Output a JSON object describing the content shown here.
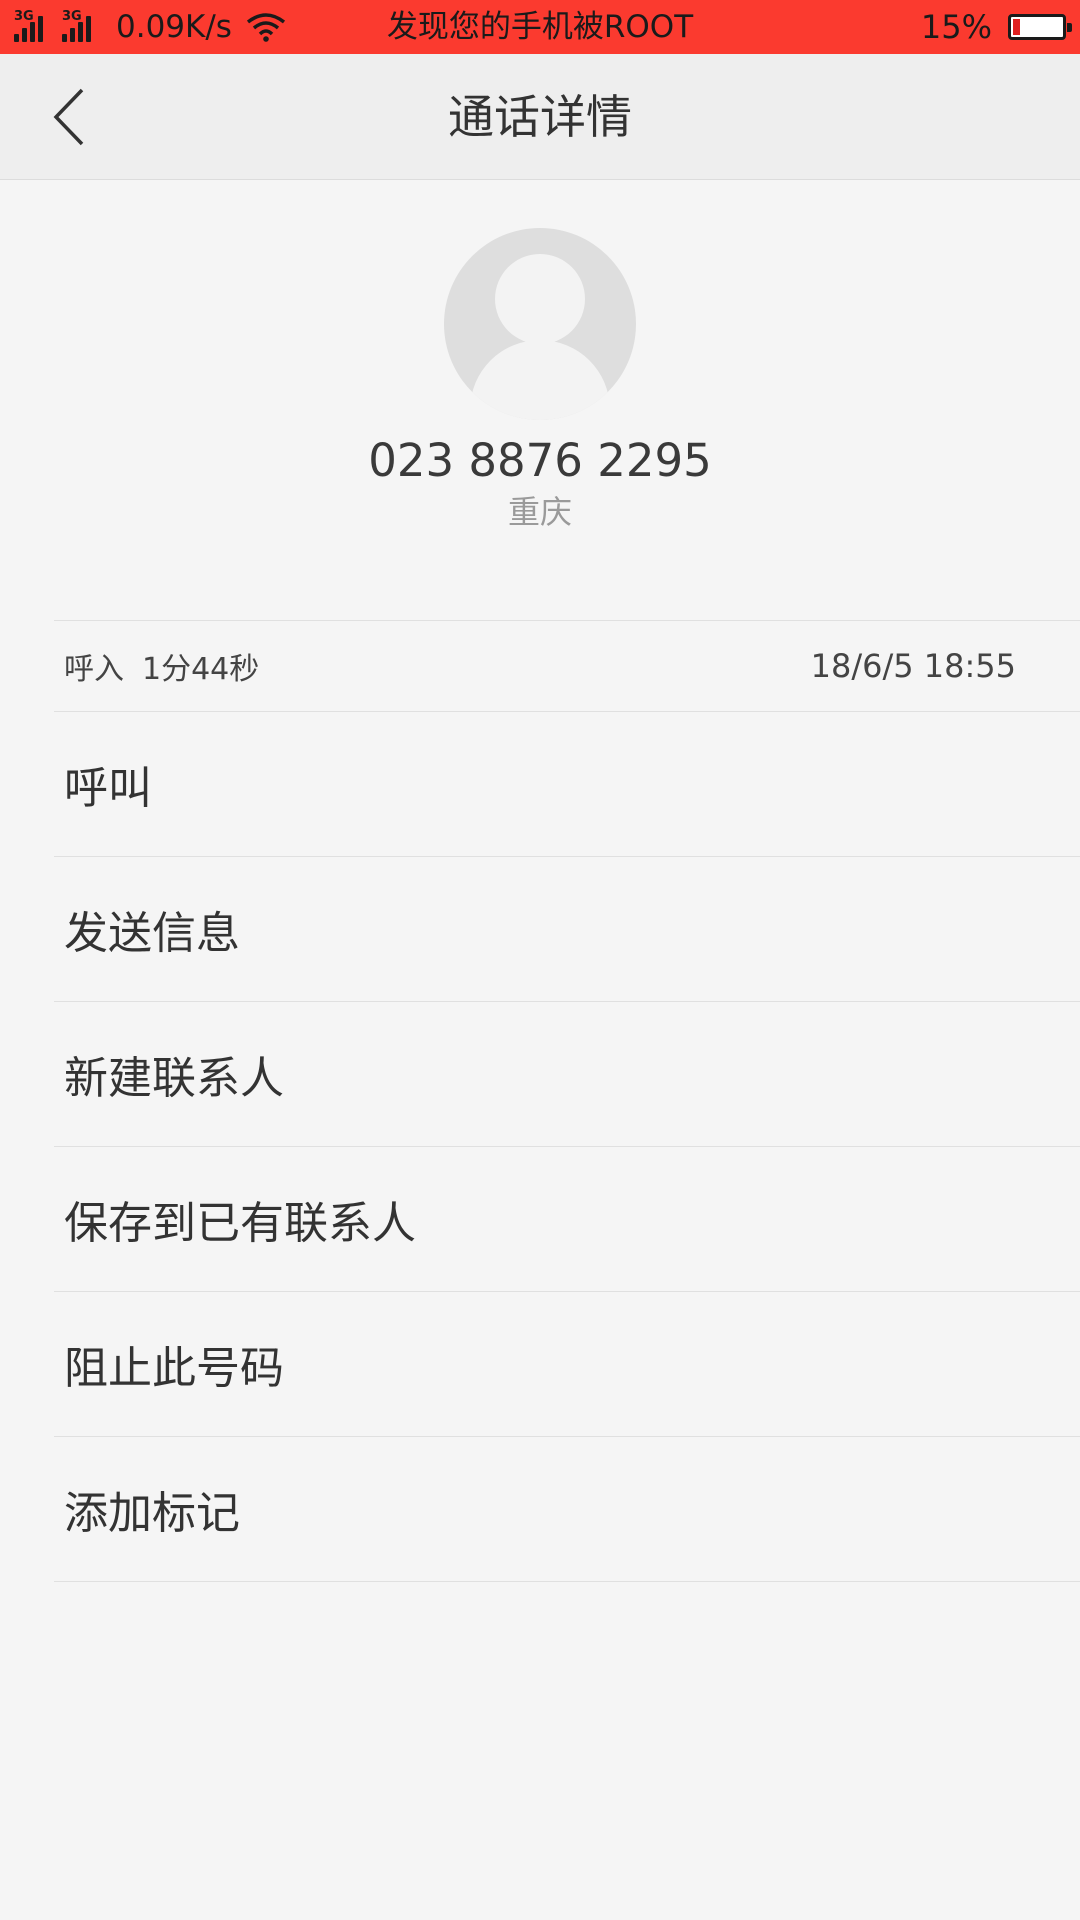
{
  "status_bar": {
    "signal1_label": "3G",
    "signal2_label": "3G",
    "net_speed": "0.09K/s",
    "title": "发现您的手机被ROOT",
    "battery_percent": "15%",
    "battery_level": 0.15,
    "color": "#fb3a2f"
  },
  "header": {
    "title": "通话详情",
    "back_icon": "chevron-left-icon"
  },
  "contact": {
    "avatar_icon": "default-avatar-icon",
    "number": "023 8876 2295",
    "location": "重庆"
  },
  "call_record": {
    "type": "呼入",
    "duration": "1分44秒",
    "time": "18/6/5 18:55"
  },
  "actions": [
    {
      "label": "呼叫"
    },
    {
      "label": "发送信息"
    },
    {
      "label": "新建联系人"
    },
    {
      "label": "保存到已有联系人"
    },
    {
      "label": "阻止此号码"
    },
    {
      "label": "添加标记"
    }
  ]
}
